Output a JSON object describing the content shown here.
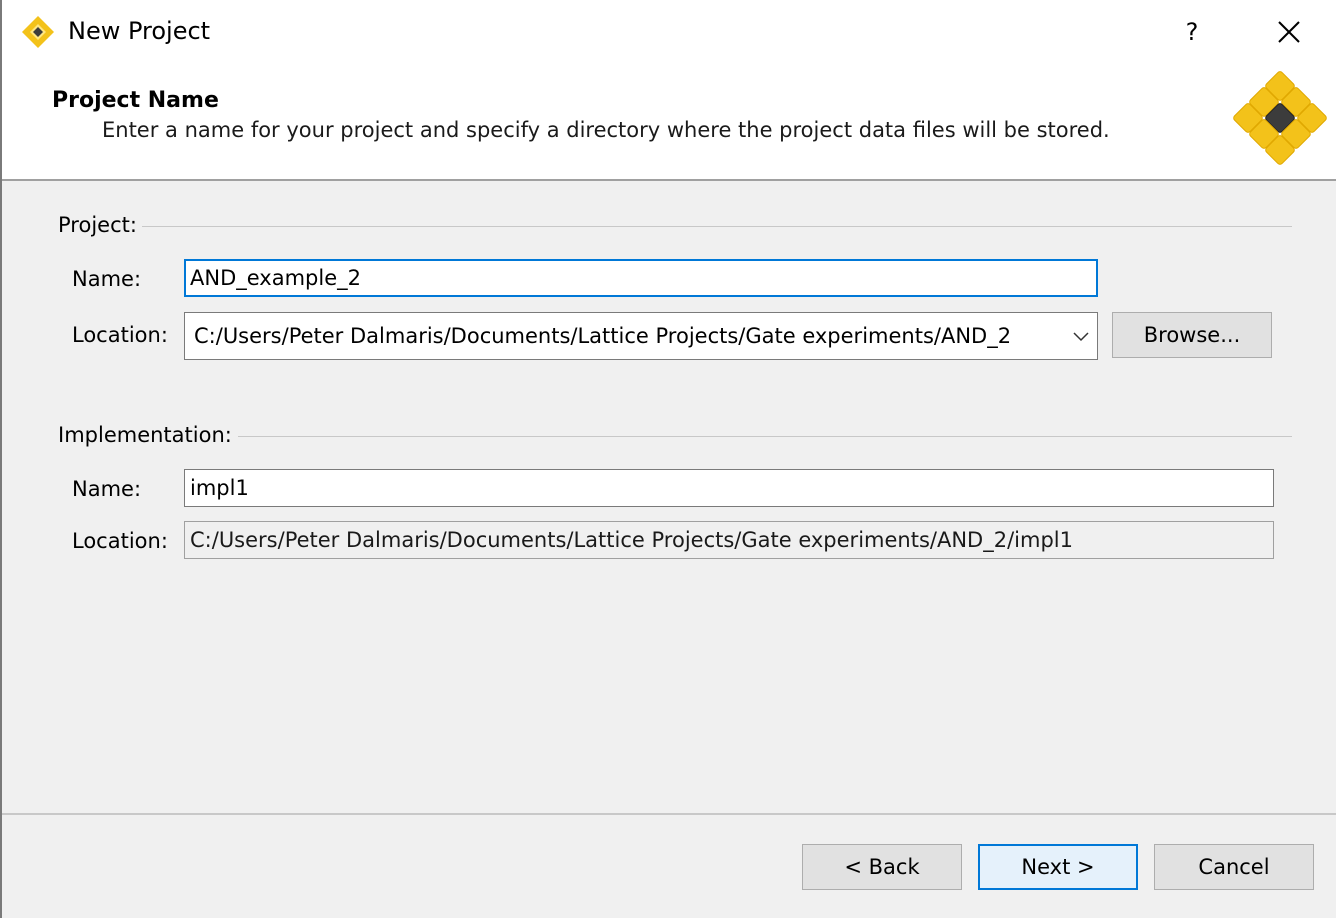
{
  "window": {
    "title": "New Project",
    "help_label": "?",
    "close_icon": "close-icon",
    "app_icon": "lattice-diamond-icon"
  },
  "header": {
    "title": "Project Name",
    "description": "Enter a name for your project and specify a directory where the project data files will be stored.",
    "logo_icon": "lattice-diamond-logo",
    "colors": {
      "gold": "#f3c21a",
      "dark": "#3c3c3c"
    }
  },
  "project": {
    "group_label": "Project:",
    "name_label": "Name:",
    "name_value": "AND_example_2",
    "location_label": "Location:",
    "location_value": "C:/Users/Peter Dalmaris/Documents/Lattice Projects/Gate experiments/AND_2",
    "browse_label": "Browse..."
  },
  "implementation": {
    "group_label": "Implementation:",
    "name_label": "Name:",
    "name_value": "impl1",
    "location_label": "Location:",
    "location_value": "C:/Users/Peter Dalmaris/Documents/Lattice Projects/Gate experiments/AND_2/impl1"
  },
  "footer": {
    "back_label": "< Back",
    "next_label": "Next >",
    "cancel_label": "Cancel"
  },
  "colors": {
    "focus_border": "#0078d7",
    "panel_bg": "#f0f0f0",
    "default_button_bg": "#e5f1fb"
  }
}
